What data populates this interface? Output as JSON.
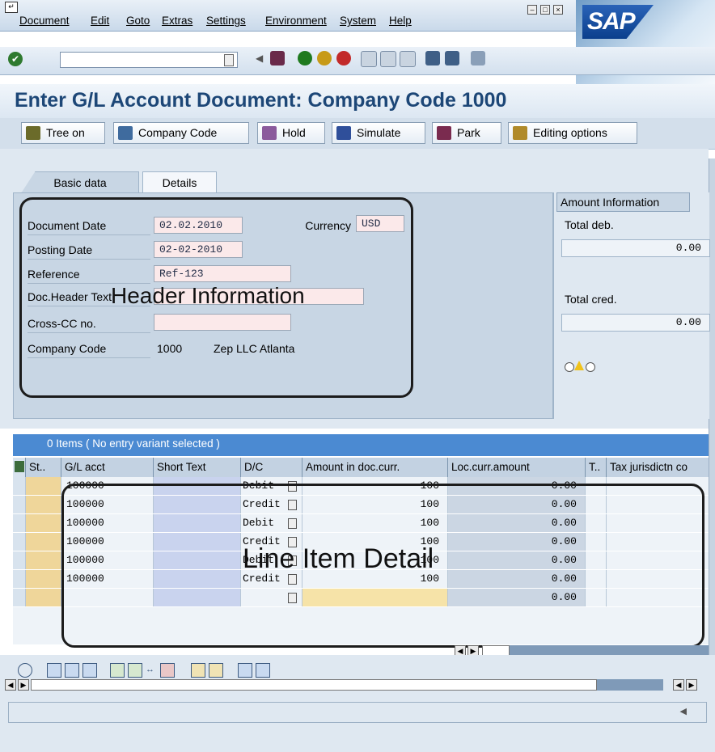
{
  "menu": [
    "Document",
    "Edit",
    "Goto",
    "Extras",
    "Settings",
    "Environment",
    "System",
    "Help"
  ],
  "brand": "SAP",
  "title": "Enter G/L Account Document: Company Code 1000",
  "app_toolbar": [
    {
      "label": "Tree on",
      "icon": "tree-icon",
      "color": "#6b6b2a"
    },
    {
      "label": "Company Code",
      "icon": "company-code-icon",
      "color": "#3f6b9e"
    },
    {
      "label": "Hold",
      "icon": "hold-icon",
      "color": "#8b5a9c"
    },
    {
      "label": "Simulate",
      "icon": "simulate-icon",
      "color": "#2f4f9a"
    },
    {
      "label": "Park",
      "icon": "park-icon",
      "color": "#7a2b4f"
    },
    {
      "label": "Editing options",
      "icon": "pencil-icon",
      "color": "#b08a2a"
    }
  ],
  "tabs": [
    "Basic data",
    "Details"
  ],
  "header_fields": {
    "doc_date": {
      "label": "Document Date",
      "value": "02.02.2010"
    },
    "posting_date": {
      "label": "Posting Date",
      "value": "02-02-2010"
    },
    "reference": {
      "label": "Reference",
      "value": "Ref-123"
    },
    "doc_header": {
      "label": "Doc.Header Text",
      "value": ""
    },
    "cross_cc": {
      "label": "Cross-CC no.",
      "value": ""
    },
    "company_code": {
      "label": "Company Code",
      "value": "1000",
      "name": "Zep LLC Atlanta"
    },
    "currency": {
      "label": "Currency",
      "value": "USD"
    }
  },
  "amount_info": {
    "title": "Amount Information",
    "total_deb_label": "Total deb.",
    "total_deb": "0.00",
    "total_cred_label": "Total cred.",
    "total_cred": "0.00"
  },
  "overlays": {
    "header": "Header Information",
    "line": "Line Item Detail"
  },
  "table": {
    "caption": "0 Items ( No entry variant selected )",
    "columns": [
      "St..",
      "G/L acct",
      "Short Text",
      "D/C",
      "Amount in doc.curr.",
      "Loc.curr.amount",
      "T..",
      "Tax jurisdictn co"
    ],
    "rows": [
      {
        "gl": "100000",
        "text": "",
        "dc": "Debit",
        "amount": "100",
        "loc": "0.00"
      },
      {
        "gl": "100000",
        "text": "",
        "dc": "Credit",
        "amount": "100",
        "loc": "0.00"
      },
      {
        "gl": "100000",
        "text": "",
        "dc": "Debit",
        "amount": "100",
        "loc": "0.00"
      },
      {
        "gl": "100000",
        "text": "",
        "dc": "Credit",
        "amount": "100",
        "loc": "0.00"
      },
      {
        "gl": "100000",
        "text": "",
        "dc": "Debit",
        "amount": "100",
        "loc": "0.00"
      },
      {
        "gl": "100000",
        "text": "",
        "dc": "Credit",
        "amount": "100",
        "loc": "0.00"
      },
      {
        "gl": "",
        "text": "",
        "dc": "",
        "amount": "",
        "loc": "0.00"
      }
    ]
  }
}
